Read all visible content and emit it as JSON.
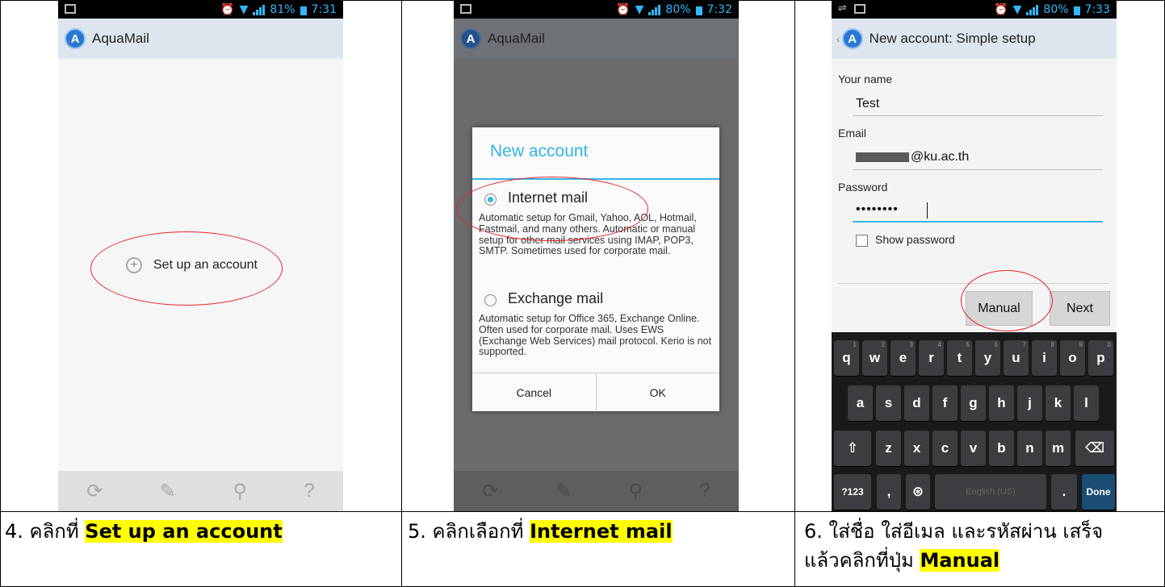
{
  "status": {
    "panel1": {
      "battery": "81%",
      "time": "7:31"
    },
    "panel2": {
      "battery": "80%",
      "time": "7:32"
    },
    "panel3": {
      "battery": "80%",
      "time": "7:33"
    }
  },
  "app": {
    "name": "AquaMail"
  },
  "panel1": {
    "setup_label": "Set up an account"
  },
  "panel2": {
    "dialog_title": "New account",
    "option1_label": "Internet mail",
    "option1_desc": "Automatic setup for Gmail, Yahoo, AOL, Hotmail, Fastmail, and many others. Automatic or manual setup for other mail services using IMAP, POP3, SMTP. Sometimes used for corporate mail.",
    "option2_label": "Exchange mail",
    "option2_desc": "Automatic setup for Office 365, Exchange Online. Often used for corporate mail. Uses EWS (Exchange Web Services) mail protocol. Kerio is not supported.",
    "cancel": "Cancel",
    "ok": "OK"
  },
  "panel3": {
    "title": "New account: Simple setup",
    "name_label": "Your name",
    "name_value": "Test",
    "email_label": "Email",
    "email_value": "@ku.ac.th",
    "password_label": "Password",
    "password_value": "••••••••",
    "show_password": "Show password",
    "manual": "Manual",
    "next": "Next",
    "keyboard": {
      "row1": [
        "q",
        "w",
        "e",
        "r",
        "t",
        "y",
        "u",
        "i",
        "o",
        "p"
      ],
      "row1_hints": [
        "1",
        "2",
        "3",
        "4",
        "5",
        "6",
        "7",
        "8",
        "9",
        "0"
      ],
      "row2": [
        "a",
        "s",
        "d",
        "f",
        "g",
        "h",
        "j",
        "k",
        "l"
      ],
      "row3": [
        "z",
        "x",
        "c",
        "v",
        "b",
        "n",
        "m"
      ],
      "sym": "?123",
      "comma": ",",
      "space": "English (US)",
      "period": ".",
      "done": "Done"
    }
  },
  "captions": {
    "c1_prefix": "4.  คลิกที่ ",
    "c1_hl": "Set up an account",
    "c2_prefix": "5.  คลิกเลือกที่ ",
    "c2_hl": "Internet mail",
    "c3_line1": "6. ใส่ชื่อ ใส่อีเมล และรหัสผ่าน เสร็จ",
    "c3_prefix": "แล้วคลิกที่ปุ่ม ",
    "c3_hl": "Manual"
  }
}
